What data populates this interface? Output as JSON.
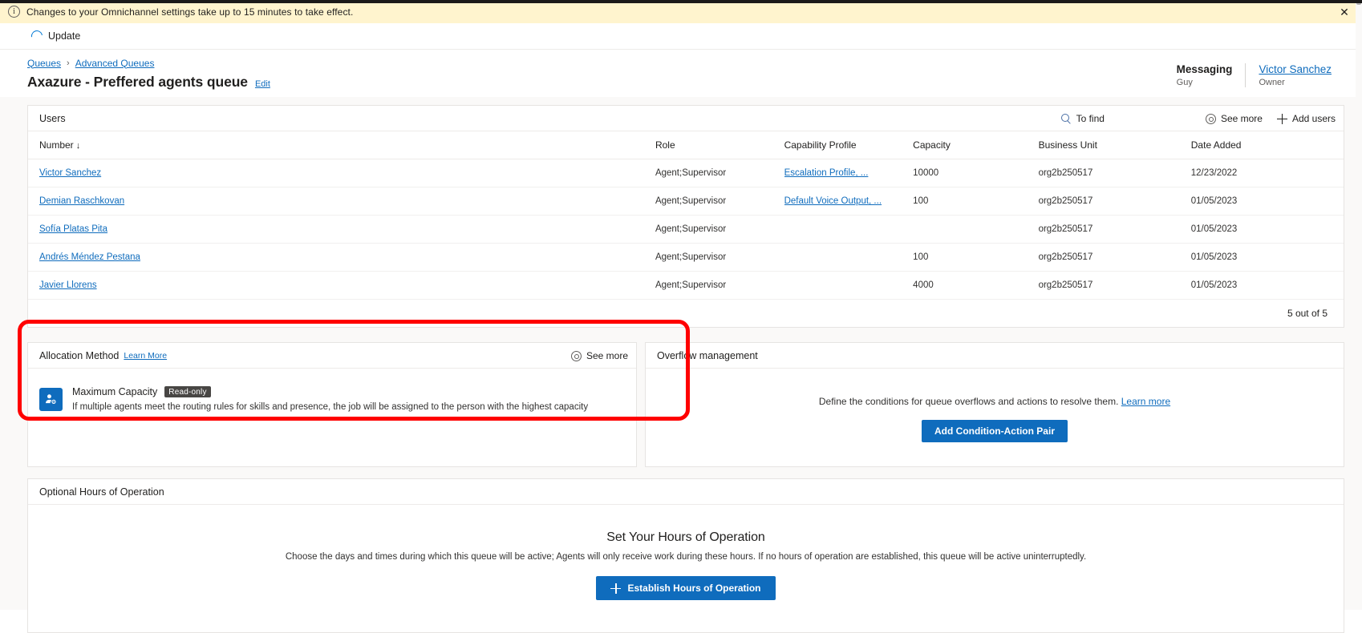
{
  "notification": {
    "icon": "info-circle-icon",
    "text": "Changes to your Omnichannel settings take up to 15 minutes to take effect.",
    "close_label": "✕"
  },
  "command_bar": {
    "update_label": "Update",
    "update_icon": "refresh-spinner-icon"
  },
  "header": {
    "breadcrumb": [
      {
        "label": "Queues"
      },
      {
        "label": "Advanced Queues"
      }
    ],
    "breadcrumb_separator": "›",
    "title": "Axazure - Preffered agents queue",
    "edit_label": "Edit",
    "fields": [
      {
        "value": "Messaging",
        "label": "Guy",
        "is_link": false
      },
      {
        "value": "Victor Sanchez",
        "label": "Owner",
        "is_link": true
      }
    ]
  },
  "users_panel": {
    "title": "Users",
    "search_label": "To find",
    "search_icon": "search-icon",
    "see_more_label": "See more",
    "see_more_icon": "gear-icon",
    "add_users_label": "Add users",
    "add_users_icon": "plus-icon",
    "columns": [
      "Number",
      "Role",
      "Capability Profile",
      "Capacity",
      "Business Unit",
      "Date Added"
    ],
    "sort_indicator": "↓",
    "rows": [
      {
        "name": "Victor Sanchez",
        "role": "Agent;Supervisor",
        "capability_profile": "Escalation Profile, ...",
        "capacity": "10000",
        "business_unit": "org2b250517",
        "date_added": "12/23/2022"
      },
      {
        "name": "Demian Raschkovan",
        "role": "Agent;Supervisor",
        "capability_profile": "Default Voice Output, ...",
        "capacity": "100",
        "business_unit": "org2b250517",
        "date_added": "01/05/2023"
      },
      {
        "name": "Sofía Platas Pita",
        "role": "Agent;Supervisor",
        "capability_profile": "",
        "capacity": "",
        "business_unit": "org2b250517",
        "date_added": "01/05/2023"
      },
      {
        "name": "Andrés Méndez Pestana",
        "role": "Agent;Supervisor",
        "capability_profile": "",
        "capacity": "100",
        "business_unit": "org2b250517",
        "date_added": "01/05/2023"
      },
      {
        "name": "Javier Llorens",
        "role": "Agent;Supervisor",
        "capability_profile": "",
        "capacity": "4000",
        "business_unit": "org2b250517",
        "date_added": "01/05/2023"
      }
    ],
    "footer_count": "5 out of 5"
  },
  "allocation_panel": {
    "title": "Allocation Method",
    "learn_more_label": "Learn More",
    "see_more_label": "See more",
    "see_more_icon": "gear-icon",
    "method_icon": "user-capacity-icon",
    "method_title": "Maximum Capacity",
    "method_badge": "Read-only",
    "method_description": "If multiple agents meet the routing rules for skills and presence, the job will be assigned to the person with the highest capacity"
  },
  "overflow_panel": {
    "title": "Overflow management",
    "description": "Define the conditions for queue overflows and actions to resolve them.",
    "learn_more_label": "Learn more",
    "button_label": "Add Condition-Action Pair"
  },
  "hours_panel": {
    "title": "Optional Hours of Operation",
    "heading": "Set Your Hours of Operation",
    "description": "Choose the days and times during which this queue will be active; Agents will only receive work during these hours. If no hours of operation are established, this queue will be active uninterruptedly.",
    "button_label": "Establish Hours of Operation",
    "button_icon": "plus-icon"
  },
  "colors": {
    "accent": "#0f6cbd",
    "notification_bg": "#fff4ce",
    "highlight": "#ff0000",
    "badge": "#484644"
  }
}
